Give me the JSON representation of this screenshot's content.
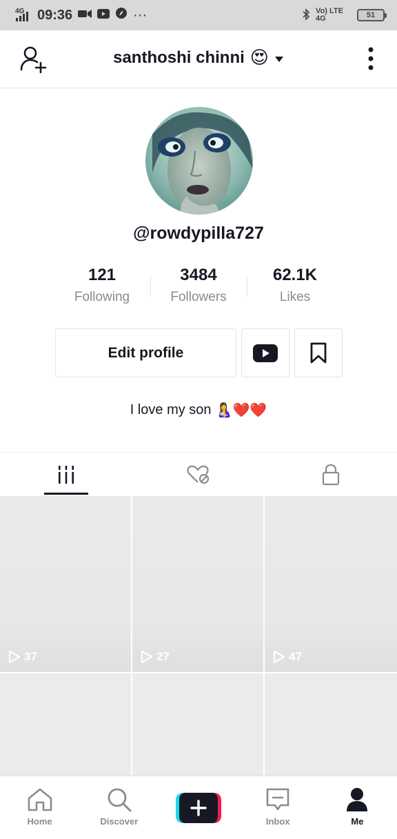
{
  "status_bar": {
    "network": "4G",
    "time": "09:36",
    "dots": "···",
    "right_text": "Vo) LTE 4G",
    "battery": "51"
  },
  "header": {
    "title": "santhoshi chinni",
    "title_emoji": "😍"
  },
  "profile": {
    "username": "@rowdypilla727",
    "stats": [
      {
        "value": "121",
        "label": "Following"
      },
      {
        "value": "3484",
        "label": "Followers"
      },
      {
        "value": "62.1K",
        "label": "Likes"
      }
    ],
    "edit_profile_label": "Edit profile",
    "bio_text": "I love my son",
    "bio_emoji": "🤱❤️❤️"
  },
  "tabs": [
    {
      "icon": "grid-icon",
      "active": true
    },
    {
      "icon": "liked-hidden-icon",
      "active": false
    },
    {
      "icon": "lock-icon",
      "active": false
    }
  ],
  "videos": [
    {
      "views": "37"
    },
    {
      "views": "27"
    },
    {
      "views": "47"
    }
  ],
  "bottom_nav": {
    "home": "Home",
    "discover": "Discover",
    "inbox": "Inbox",
    "me": "Me"
  },
  "colors": {
    "text_primary": "#161823",
    "text_secondary": "#8a8b91",
    "accent_cyan": "#20d5ec",
    "accent_pink": "#ee1d52",
    "youtube_red": "#161823"
  }
}
